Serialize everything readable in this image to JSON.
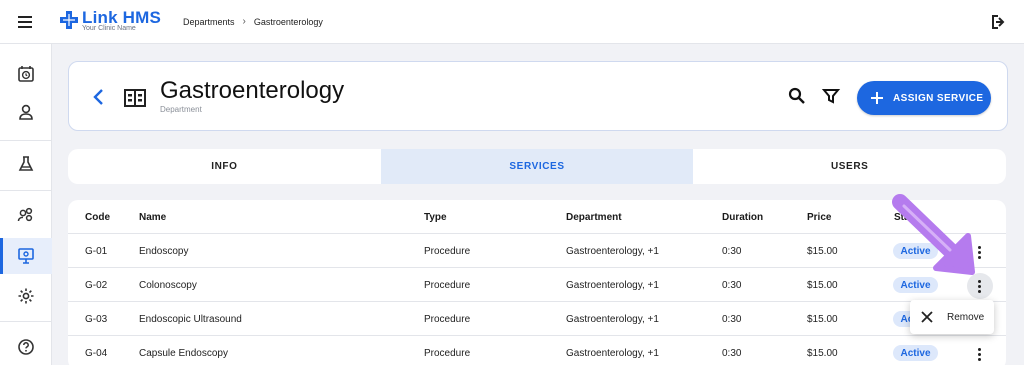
{
  "app": {
    "title": "Link HMS",
    "subtitle": "Your Clinic Name"
  },
  "breadcrumb": [
    "Departments",
    "Gastroenterology"
  ],
  "breadcrumb_separator": "›",
  "header": {
    "title": "Gastroenterology",
    "subtitle": "Department",
    "assign_button": "ASSIGN SERVICE"
  },
  "tabs": [
    {
      "label": "INFO",
      "active": false
    },
    {
      "label": "SERVICES",
      "active": true
    },
    {
      "label": "USERS",
      "active": false
    }
  ],
  "table": {
    "columns": [
      "Code",
      "Name",
      "Type",
      "Department",
      "Duration",
      "Price",
      "Status"
    ],
    "rows": [
      {
        "code": "G-01",
        "name": "Endoscopy",
        "type": "Procedure",
        "department": "Gastroenterology, +1",
        "duration": "0:30",
        "price": "$15.00",
        "status": "Active"
      },
      {
        "code": "G-02",
        "name": "Colonoscopy",
        "type": "Procedure",
        "department": "Gastroenterology, +1",
        "duration": "0:30",
        "price": "$15.00",
        "status": "Active"
      },
      {
        "code": "G-03",
        "name": "Endoscopic Ultrasound",
        "type": "Procedure",
        "department": "Gastroenterology, +1",
        "duration": "0:30",
        "price": "$15.00",
        "status": "Active"
      },
      {
        "code": "G-04",
        "name": "Capsule Endoscopy",
        "type": "Procedure",
        "department": "Gastroenterology, +1",
        "duration": "0:30",
        "price": "$15.00",
        "status": "Active"
      }
    ]
  },
  "row_menu": {
    "items": [
      {
        "label": "Remove",
        "icon": "close-icon"
      }
    ]
  },
  "sidebar": {
    "items": [
      {
        "icon": "calendar-clock-icon",
        "active": false
      },
      {
        "icon": "person-icon",
        "active": false
      },
      {
        "icon": "lab-flask-icon",
        "active": false
      },
      {
        "icon": "users-group-icon",
        "active": false
      },
      {
        "icon": "monitor-settings-icon",
        "active": true
      },
      {
        "icon": "settings-gear-icon",
        "active": false
      },
      {
        "icon": "help-icon",
        "active": false
      }
    ]
  },
  "colors": {
    "accent": "#1d67e0",
    "tab_active_bg": "#e1eaf8",
    "badge_bg": "#dde8fb",
    "annotation_arrow": "#b57bee"
  }
}
